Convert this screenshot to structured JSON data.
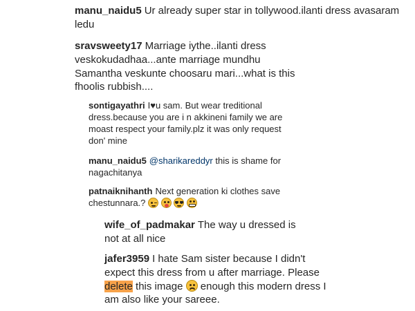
{
  "comments": [
    {
      "user": "manu_naidu5",
      "text": "Ur already super star in tollywood.ilanti dress avasaram ledu"
    },
    {
      "user": "sravsweety17",
      "text": "Marriage iythe..ilanti dress veskokudadhaa...ante marriage mundhu Samantha veskunte choosaru mari...what is this fhoolis rubbish...."
    },
    {
      "user": "sontigayathri",
      "text_before_heart": "I",
      "heart": "♥",
      "text_after_heart": "u sam. But wear treditional dress.because you are i n akkineni family we are moast respect your family.plz it was only request don' mine"
    },
    {
      "user": "manu_naidu5",
      "mention": "@sharikareddyr",
      "text": "this is shame for nagachitanya"
    },
    {
      "user": "patnaiknihanth",
      "text": "Next generation ki clothes save chestunnara.?"
    },
    {
      "user": "wife_of_padmakar",
      "text": "The way u dressed is not at all nice"
    },
    {
      "user": "jafer3959",
      "text_before": "I hate Sam sister because I didn't expect this dress from u after marriage. Please",
      "highlight": "delete",
      "text_middle": "this image",
      "text_after": "enough this modern dress I am also like your sareee."
    }
  ],
  "emojis": [
    "wink-emoji",
    "tongue-emoji",
    "sunglasses-emoji",
    "grimace-emoji",
    "sad-emoji"
  ],
  "colors": {
    "text": "#262626",
    "highlight": "#f7a24a",
    "mention": "#003569",
    "emoji": "#f7c23d"
  }
}
